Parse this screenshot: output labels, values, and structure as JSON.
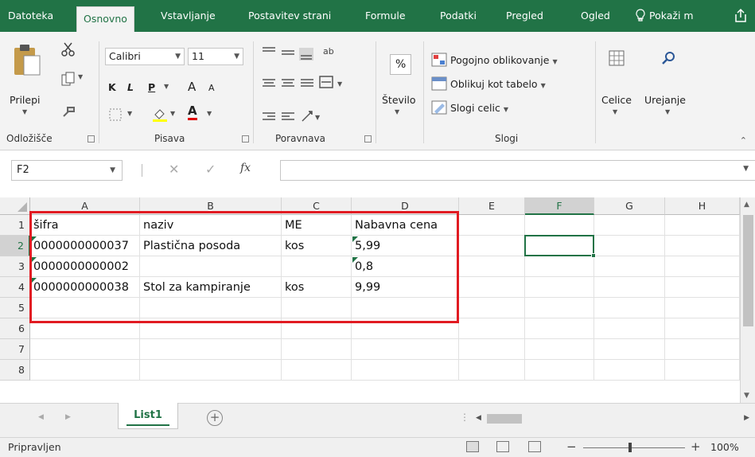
{
  "ribbon_tabs": [
    {
      "label": "Datoteka",
      "active": false
    },
    {
      "label": "Osnovno",
      "active": true
    },
    {
      "label": "Vstavljanje",
      "active": false
    },
    {
      "label": "Postavitev strani",
      "active": false
    },
    {
      "label": "Formule",
      "active": false
    },
    {
      "label": "Podatki",
      "active": false
    },
    {
      "label": "Pregled",
      "active": false
    },
    {
      "label": "Ogled",
      "active": false
    }
  ],
  "tell_me": "Pokaži m",
  "clipboard": {
    "paste_label": "Prilepi",
    "group_label": "Odložišče"
  },
  "font": {
    "name": "Calibri",
    "size": "11",
    "bold": "K",
    "italic": "L",
    "underline": "P",
    "grow": "A",
    "shrink": "A",
    "font_color": "A",
    "group_label": "Pisava"
  },
  "alignment": {
    "group_label": "Poravnava"
  },
  "number": {
    "percent": "%",
    "label": "Število"
  },
  "styles": {
    "conditional": "Pogojno oblikovanje",
    "table": "Oblikuj kot tabelo",
    "cell_styles": "Slogi celic",
    "group_label": "Slogi"
  },
  "cells_label": "Celice",
  "editing_label": "Urejanje",
  "formula_bar": {
    "name_box": "F2",
    "fx": "fx",
    "content": ""
  },
  "columns": [
    "A",
    "B",
    "C",
    "D",
    "E",
    "F",
    "G",
    "H"
  ],
  "selected_column": "F",
  "rows": [
    "1",
    "2",
    "3",
    "4",
    "5",
    "6",
    "7",
    "8"
  ],
  "selected_row": "2",
  "cells": {
    "A1": "šifra",
    "B1": "naziv",
    "C1": "ME",
    "D1": "Nabavna cena",
    "A2": "0000000000037",
    "B2": "Plastična posoda",
    "C2": "kos",
    "D2": "5,99",
    "A3": "0000000000002",
    "B3": "",
    "C3": "",
    "D3": "0,8",
    "A4": "0000000000038",
    "B4": "Stol za kampiranje",
    "C4": "kos",
    "D4": "9,99"
  },
  "active_cell": "F2",
  "sheet_tab": "List1",
  "status": "Pripravljen",
  "zoom": "100%",
  "colors": {
    "accent": "#217346",
    "highlight_box": "#e11b22",
    "error_marker": "#217346"
  }
}
